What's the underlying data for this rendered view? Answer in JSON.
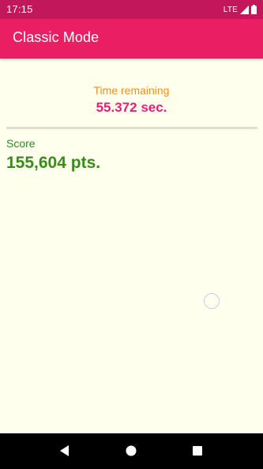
{
  "status_bar": {
    "time": "17:15",
    "network": "LTE",
    "icons": [
      "signal-icon",
      "battery-icon"
    ]
  },
  "app_bar": {
    "title": "Classic Mode"
  },
  "timer": {
    "label": "Time remaining",
    "value": "55.372 sec."
  },
  "score": {
    "label": "Score",
    "value": "155,604 pts."
  },
  "nav_bar": {
    "icons": [
      "back-icon",
      "home-icon",
      "recents-icon"
    ]
  },
  "colors": {
    "status_bar": "#C2185B",
    "app_bar": "#E91E63",
    "background": "#FFFFEE",
    "timer_label": "#FF8C1A",
    "timer_value": "#E91E7A",
    "score": "#3A8C1A",
    "target": "#C8CCE8",
    "nav_bar": "#000000"
  }
}
